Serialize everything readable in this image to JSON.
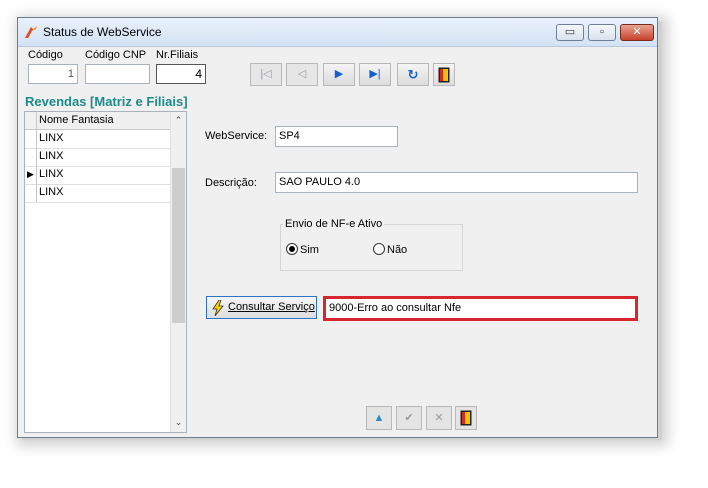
{
  "window": {
    "title": "Status de WebService",
    "controls": {
      "minimize": "▭",
      "maximize": "▫",
      "close": "✕"
    }
  },
  "header": {
    "codigo_label": "Código",
    "codigo_value": "1",
    "codigo_cnp_label": "Código CNP",
    "codigo_cnp_value": "",
    "nr_filiais_label": "Nr.Filiais",
    "nr_filiais_value": "4"
  },
  "navigator": {
    "first": "|◁",
    "prior": "◁",
    "next": "▶",
    "last": "▶|",
    "refresh": "↻"
  },
  "revendas": {
    "title": "Revendas [Matriz e Filiais]",
    "column": "Nome Fantasia",
    "rows": [
      "LINX",
      "LINX",
      "LINX",
      "LINX"
    ],
    "current_row_marker": "▶"
  },
  "form": {
    "webservice_label": "WebService:",
    "webservice_value": "SP4",
    "descricao_label": "Descrição:",
    "descricao_value": "SAO PAULO 4.0",
    "envio_group_label": "Envio de NF-e Ativo",
    "sim_label": "Sim",
    "nao_label": "Não",
    "consultar_button": "Consultar Serviço",
    "result_value": "9000-Erro ao consultar Nfe"
  },
  "bottom_toolbar": {
    "up": "▲",
    "confirm": "✔",
    "cancel": "✕"
  },
  "colors": {
    "highlight": "#d8262e",
    "section_title": "#1f8a8a",
    "nav_icon": "#1560c8"
  }
}
